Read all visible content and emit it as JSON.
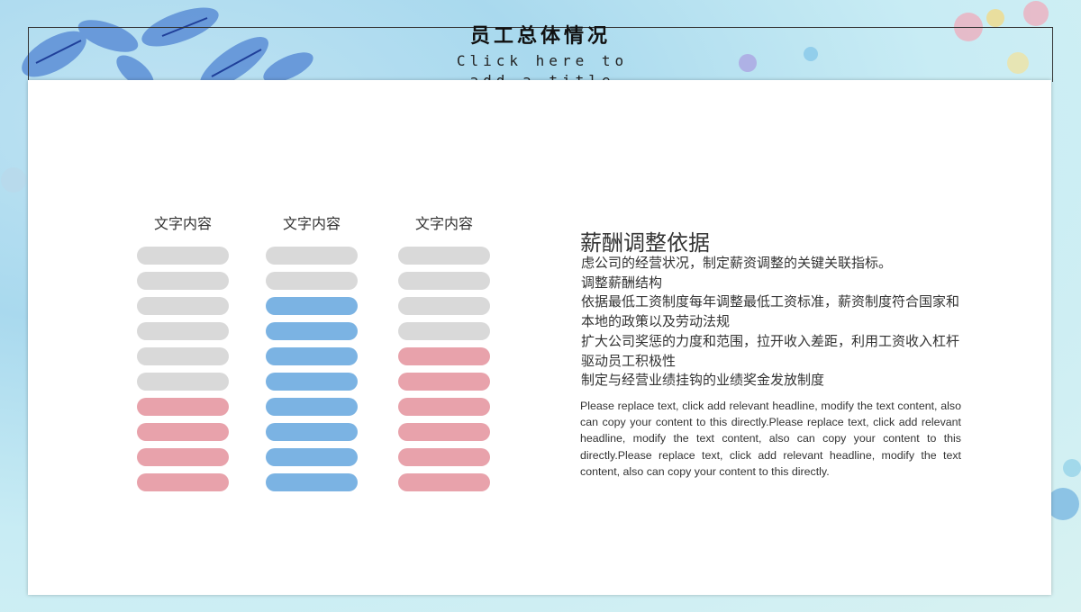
{
  "header": {
    "title": "员工总体情况",
    "subtitle": "Click here to add a title"
  },
  "columns": [
    {
      "label": "文字内容",
      "pills": [
        "gray",
        "gray",
        "gray",
        "gray",
        "gray",
        "gray",
        "pink",
        "pink",
        "pink",
        "pink"
      ]
    },
    {
      "label": "文字内容",
      "pills": [
        "gray",
        "gray",
        "blue",
        "blue",
        "blue",
        "blue",
        "blue",
        "blue",
        "blue",
        "blue"
      ]
    },
    {
      "label": "文字内容",
      "pills": [
        "gray",
        "gray",
        "gray",
        "gray",
        "pink",
        "pink",
        "pink",
        "pink",
        "pink",
        "pink"
      ]
    }
  ],
  "colors": {
    "gray": "#d9d9d9",
    "blue": "#7bb3e3",
    "pink": "#e8a2ab"
  },
  "content": {
    "heading": "薪酬调整依据",
    "lines": [
      "虑公司的经营状况，制定薪资调整的关键关联指标。",
      "调整薪酬结构",
      "依据最低工资制度每年调整最低工资标准，薪资制度符合国家和",
      "本地的政策以及劳动法规",
      "扩大公司奖惩的力度和范围，拉开收入差距，利用工资收入杠杆",
      "驱动员工积极性",
      "制定与经营业绩挂钩的业绩奖金发放制度"
    ],
    "body": "Please replace text, click add relevant headline, modify the text content, also can copy your content to this directly.Please replace text, click add relevant headline, modify the text content, also can copy your content to this directly.Please replace text, click add relevant headline, modify the text content, also can copy your content to this directly."
  }
}
